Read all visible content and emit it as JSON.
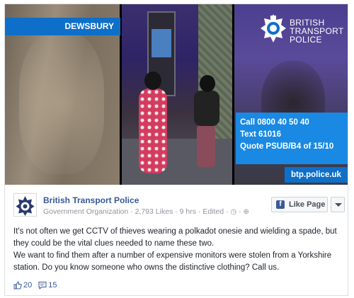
{
  "banner": {
    "location": "DEWSBURY",
    "logo_text": [
      "BRITISH",
      "TRANSPORT",
      "POLICE"
    ],
    "call_line": "Call 0800 40 50 40",
    "text_line": "Text 61016",
    "quote_line": "Quote PSUB/B4 of 15/10",
    "website": "btp.police.uk"
  },
  "post": {
    "page_name": "British Transport Police",
    "category": "Government Organization",
    "likes": "2,793 Likes",
    "time": "9 hrs",
    "edited": "Edited",
    "like_page_label": "Like Page",
    "message_line1": "It's not often we get CCTV of thieves wearing a polkadot onesie and wielding a spade, but they could be the vital clues needed to name these two.",
    "message_line2": "We want to find them after a number of expensive monitors were stolen from a Yorkshire station. Do you know someone who owns the distinctive clothing? Call us.",
    "reaction_count": "20",
    "comment_count": "15"
  },
  "colors": {
    "brand_blue": "#0e6fc9",
    "call_box": "#1a89e3",
    "fb_link": "#365899"
  }
}
